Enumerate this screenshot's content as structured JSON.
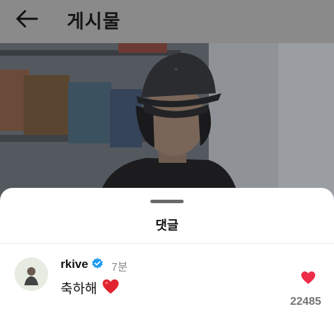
{
  "header": {
    "title": "게시물",
    "back_icon": "arrow-left-icon"
  },
  "post": {
    "photo": "person-in-cap-photo"
  },
  "comments_sheet": {
    "title": "댓글",
    "comments": [
      {
        "username": "rkive",
        "verified": true,
        "time": "7분",
        "text": "축하해",
        "emoji": "red-heart-emoji",
        "like_count": "22485",
        "liked": true
      }
    ]
  },
  "colors": {
    "verified": "#1d9bf0",
    "like": "#ed2d4a",
    "dim_overlay": "#8a8a8a"
  }
}
